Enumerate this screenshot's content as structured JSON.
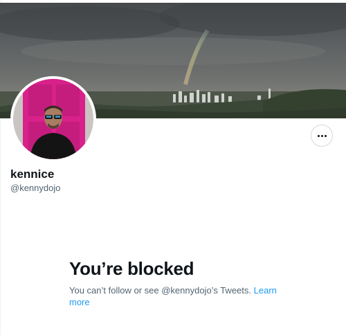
{
  "profile": {
    "display_name": "kennice",
    "handle": "@kennydojo"
  },
  "banner": {
    "description_icon": "banner-image"
  },
  "more_button": {
    "icon": "more-horizontal-icon"
  },
  "blocked": {
    "title": "You’re blocked",
    "message": "You can’t follow or see @kennydojo’s Tweets. ",
    "link": "Learn more"
  },
  "colors": {
    "link": "#1d9bf0",
    "secondary_text": "#536471",
    "primary_text": "#0f1419",
    "avatar_door": "#d8218a"
  }
}
